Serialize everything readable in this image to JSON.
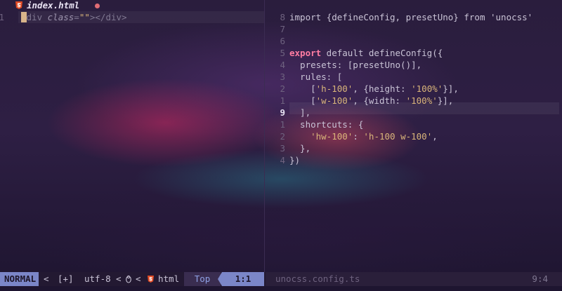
{
  "tab": {
    "filename": "index.html",
    "icon": "html5-icon",
    "modified": true,
    "colors": {
      "html_icon": "#e34c26",
      "modified_dot": "#e06c75"
    }
  },
  "left_buffer": {
    "lines": [
      {
        "number": "1",
        "tokens": [
          {
            "text": "<",
            "type": "tag"
          },
          {
            "text": "div",
            "type": "tag"
          },
          {
            "text": " ",
            "type": "plain"
          },
          {
            "text": "class",
            "type": "attr"
          },
          {
            "text": "=",
            "type": "tag"
          },
          {
            "text": "\"\"",
            "type": "str"
          },
          {
            "text": "></div>",
            "type": "tag"
          }
        ]
      }
    ]
  },
  "right_buffer": {
    "lines": [
      {
        "number": "8",
        "tokens": [
          {
            "text": "import ",
            "type": "plain"
          },
          {
            "text": "{defineConfig, presetUno}",
            "type": "plain"
          },
          {
            "text": " from ",
            "type": "plain"
          },
          {
            "text": "'unocss'",
            "type": "plain"
          }
        ]
      },
      {
        "number": "7",
        "tokens": []
      },
      {
        "number": "6",
        "tokens": []
      },
      {
        "number": "5",
        "tokens": [
          {
            "text": "export",
            "type": "kw"
          },
          {
            "text": " default defineConfig({",
            "type": "plain"
          }
        ]
      },
      {
        "number": "4",
        "tokens": [
          {
            "text": "  presets: [presetUno()],",
            "type": "plain"
          }
        ]
      },
      {
        "number": "3",
        "tokens": [
          {
            "text": "  rules: [",
            "type": "plain"
          }
        ]
      },
      {
        "number": "2",
        "tokens": [
          {
            "text": "    [",
            "type": "plain"
          },
          {
            "text": "'h-100'",
            "type": "str"
          },
          {
            "text": ", {height: ",
            "type": "plain"
          },
          {
            "text": "'100%'",
            "type": "str"
          },
          {
            "text": "}],",
            "type": "plain"
          }
        ]
      },
      {
        "number": "1",
        "tokens": [
          {
            "text": "    [",
            "type": "plain"
          },
          {
            "text": "'w-100'",
            "type": "str"
          },
          {
            "text": ", {width: ",
            "type": "plain"
          },
          {
            "text": "'100%'",
            "type": "str"
          },
          {
            "text": "}],",
            "type": "plain"
          }
        ]
      },
      {
        "number": "9",
        "current": true,
        "tokens": [
          {
            "text": "  ],",
            "type": "plain"
          }
        ]
      },
      {
        "number": "1",
        "tokens": [
          {
            "text": "  shortcuts: {",
            "type": "plain"
          }
        ]
      },
      {
        "number": "2",
        "tokens": [
          {
            "text": "    ",
            "type": "plain"
          },
          {
            "text": "'hw-100'",
            "type": "str"
          },
          {
            "text": ": ",
            "type": "plain"
          },
          {
            "text": "'h-100 w-100'",
            "type": "str"
          },
          {
            "text": ",",
            "type": "plain"
          }
        ]
      },
      {
        "number": "3",
        "tokens": [
          {
            "text": "  },",
            "type": "plain"
          }
        ]
      },
      {
        "number": "4",
        "tokens": [
          {
            "text": "})",
            "type": "plain"
          }
        ]
      }
    ]
  },
  "statusline": {
    "mode": "NORMAL",
    "mode_sep": "<",
    "modified_flag": "[+]",
    "encoding": "utf-8",
    "sep1": "<",
    "os_icon": "linux-penguin-icon",
    "sep2": "<",
    "filetype_icon": "html5-icon",
    "filetype": "html",
    "scroll": "Top",
    "position": "1:1",
    "right_filename": "unocss.config.ts",
    "right_position": "9:4",
    "colors": {
      "mode_bg": "#7b86c8",
      "scroll_fg": "#8ea0e4"
    }
  }
}
